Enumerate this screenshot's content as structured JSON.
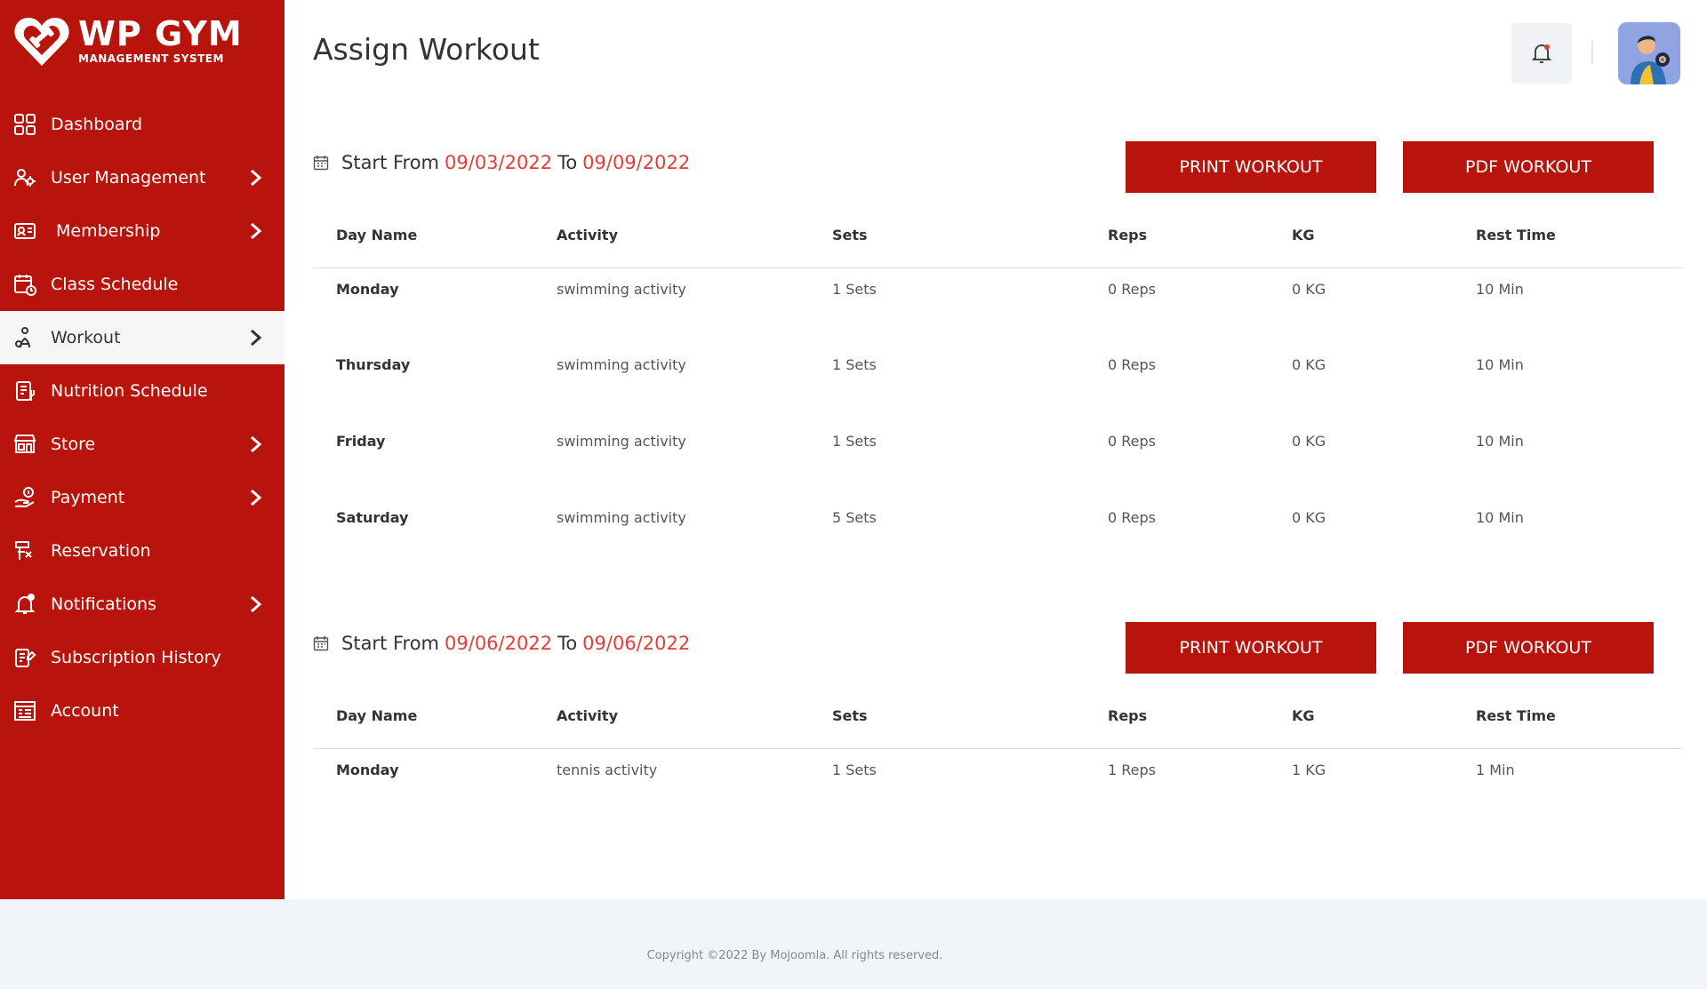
{
  "brand": {
    "title": "WP GYM",
    "subtitle": "MANAGEMENT SYSTEM",
    "color": "#b9140c"
  },
  "sidebar": {
    "items": [
      {
        "label": "Dashboard",
        "icon": "dashboard-grid-icon",
        "has_submenu": false,
        "active": false
      },
      {
        "label": "User Management",
        "icon": "users-gear-icon",
        "has_submenu": true,
        "active": false
      },
      {
        "label": "Membership",
        "icon": "membership-card-icon",
        "has_submenu": true,
        "active": false
      },
      {
        "label": "Class Schedule",
        "icon": "calendar-schedule-icon",
        "has_submenu": false,
        "active": false
      },
      {
        "label": "Workout",
        "icon": "workout-icon",
        "has_submenu": true,
        "active": true
      },
      {
        "label": "Nutrition Schedule",
        "icon": "nutrition-icon",
        "has_submenu": false,
        "active": false
      },
      {
        "label": "Store",
        "icon": "store-icon",
        "has_submenu": true,
        "active": false
      },
      {
        "label": "Payment",
        "icon": "payment-icon",
        "has_submenu": true,
        "active": false
      },
      {
        "label": "Reservation",
        "icon": "reservation-icon",
        "has_submenu": false,
        "active": false
      },
      {
        "label": "Notifications",
        "icon": "notification-bell-icon",
        "has_submenu": true,
        "active": false
      },
      {
        "label": "Subscription History",
        "icon": "subscription-history-icon",
        "has_submenu": false,
        "active": false
      },
      {
        "label": "Account",
        "icon": "account-icon",
        "has_submenu": false,
        "active": false
      }
    ]
  },
  "header": {
    "title": "Assign Workout",
    "bell_icon": "bell-icon",
    "accent_color": "#e23d36"
  },
  "columns": [
    "Day Name",
    "Activity",
    "Sets",
    "Reps",
    "KG",
    "Rest Time"
  ],
  "workouts": [
    {
      "start_label": "Start From",
      "start_date": "09/03/2022",
      "to_label": "To",
      "end_date": "09/09/2022",
      "print_label": "PRINT WORKOUT",
      "pdf_label": "PDF WORKOUT",
      "rows": [
        [
          "Monday",
          "swimming activity",
          "1 Sets",
          "0 Reps",
          "0 KG",
          "10 Min"
        ],
        [
          "Thursday",
          "swimming activity",
          "1 Sets",
          "0 Reps",
          "0 KG",
          "10 Min"
        ],
        [
          "Friday",
          "swimming activity",
          "1 Sets",
          "0 Reps",
          "0 KG",
          "10 Min"
        ],
        [
          "Saturday",
          "swimming activity",
          "5 Sets",
          "0 Reps",
          "0 KG",
          "10 Min"
        ]
      ]
    },
    {
      "start_label": "Start From",
      "start_date": "09/06/2022",
      "to_label": "To",
      "end_date": "09/06/2022",
      "print_label": "PRINT WORKOUT",
      "pdf_label": "PDF WORKOUT",
      "rows": [
        [
          "Monday",
          "tennis activity",
          "1 Sets",
          "1 Reps",
          "1 KG",
          "1 Min"
        ]
      ]
    }
  ],
  "footer": {
    "copyright": "Copyright ©2022 By Mojoomla. All rights reserved."
  }
}
